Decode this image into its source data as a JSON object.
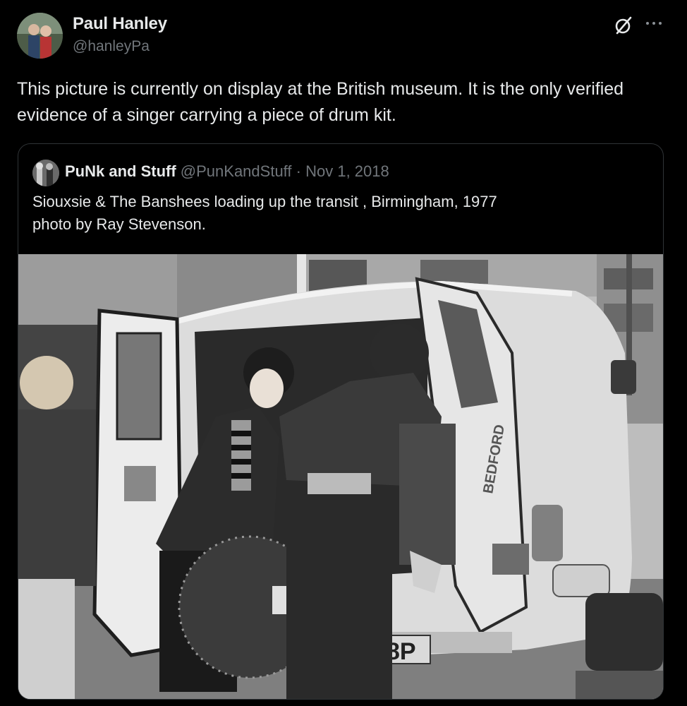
{
  "tweet": {
    "author_name": "Paul Hanley",
    "author_handle": "@hanleyPa",
    "avatar_icon": "avatar-photo",
    "text": "This picture is currently on display at the British museum. It is the only verified evidence of a singer carrying a piece of drum kit."
  },
  "actions": {
    "grok_icon": "grok-icon",
    "more_icon": "more-icon"
  },
  "quoted": {
    "author_name": "PuNk and Stuff",
    "author_handle": "@PunKandStuff",
    "separator": "·",
    "date": "Nov 1, 2018",
    "text_line1": "Siouxsie & The Banshees loading up the transit , Birmingham, 1977",
    "text_line2": "photo by Ray Stevenson.",
    "photo_plate": "NL 718P",
    "van_badge": "BEDFORD"
  },
  "colors": {
    "background": "#000000",
    "text_primary": "#e7e9ea",
    "text_secondary": "#71767b",
    "border": "#2f3336"
  }
}
